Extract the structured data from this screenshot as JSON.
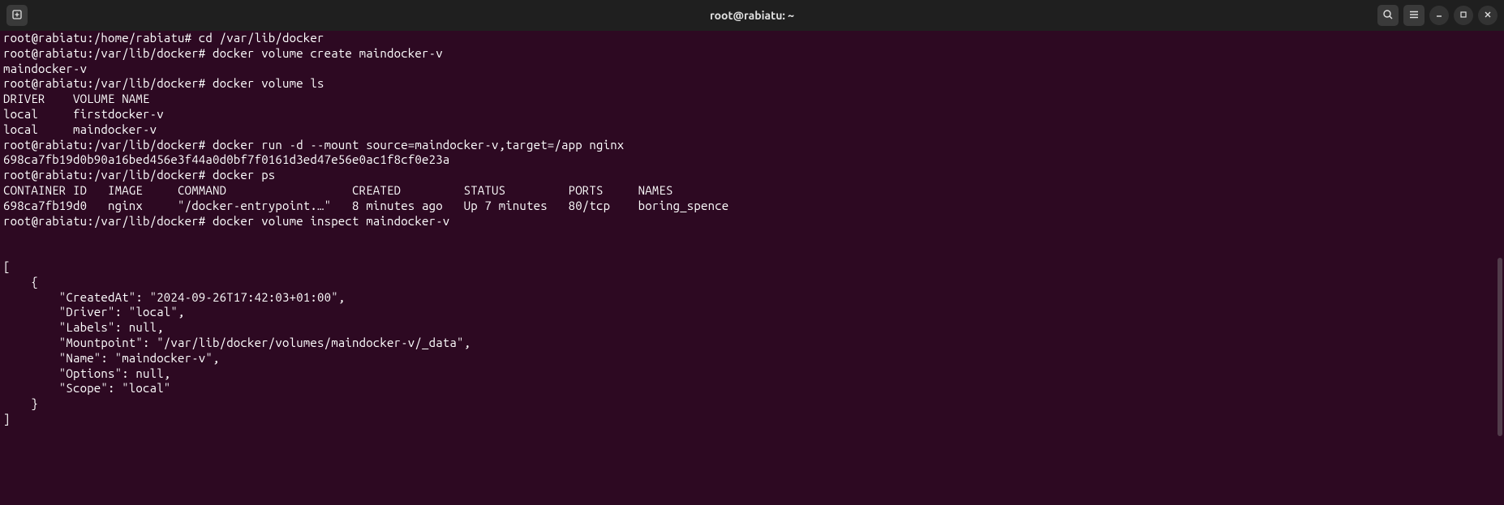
{
  "window": {
    "title": "root@rabiatu: ~"
  },
  "lines": [
    "root@rabiatu:/home/rabiatu# cd /var/lib/docker",
    "root@rabiatu:/var/lib/docker# docker volume create maindocker-v",
    "maindocker-v",
    "root@rabiatu:/var/lib/docker# docker volume ls",
    "DRIVER    VOLUME NAME",
    "local     firstdocker-v",
    "local     maindocker-v",
    "root@rabiatu:/var/lib/docker# docker run -d --mount source=maindocker-v,target=/app nginx",
    "698ca7fb19d0b90a16bed456e3f44a0d0bf7f0161d3ed47e56e0ac1f8cf0e23a",
    "root@rabiatu:/var/lib/docker# docker ps",
    "CONTAINER ID   IMAGE     COMMAND                  CREATED         STATUS         PORTS     NAMES",
    "698ca7fb19d0   nginx     \"/docker-entrypoint.…\"   8 minutes ago   Up 7 minutes   80/tcp    boring_spence",
    "root@rabiatu:/var/lib/docker# docker volume inspect maindocker-v",
    "",
    "",
    "[",
    "    {",
    "        \"CreatedAt\": \"2024-09-26T17:42:03+01:00\",",
    "        \"Driver\": \"local\",",
    "        \"Labels\": null,",
    "        \"Mountpoint\": \"/var/lib/docker/volumes/maindocker-v/_data\",",
    "        \"Name\": \"maindocker-v\",",
    "        \"Options\": null,",
    "        \"Scope\": \"local\"",
    "    }",
    "]"
  ]
}
